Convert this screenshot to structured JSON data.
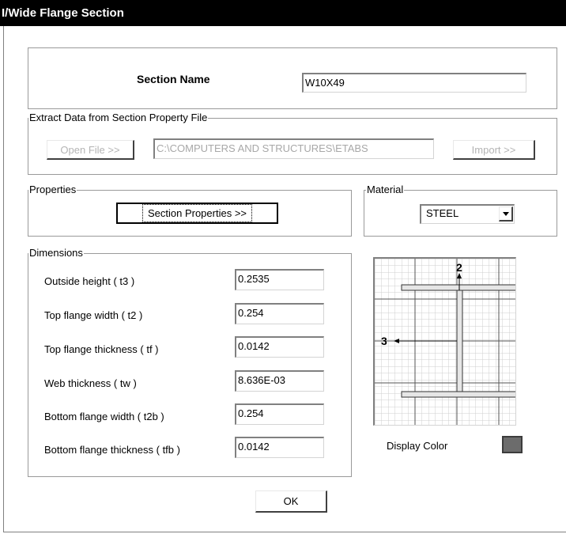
{
  "window": {
    "title": "I/Wide Flange Section"
  },
  "section_name": {
    "label": "Section Name",
    "value": "W10X49"
  },
  "extract": {
    "legend": "Extract Data from Section Property File",
    "open_file_label": "Open File >>",
    "file_path": "C:\\COMPUTERS AND STRUCTURES\\ETABS",
    "import_label": "Import >>"
  },
  "properties": {
    "legend": "Properties",
    "button_label": "Section Properties >>"
  },
  "material": {
    "legend": "Material",
    "selected": "STEEL"
  },
  "dimensions": {
    "legend": "Dimensions",
    "rows": [
      {
        "label": "Outside height  ( t3 )",
        "value": "0.2535"
      },
      {
        "label": "Top flange width  ( t2 )",
        "value": "0.254"
      },
      {
        "label": "Top flange thickness  ( tf )",
        "value": "0.0142"
      },
      {
        "label": "Web thickness  ( tw )",
        "value": "8.636E-03"
      },
      {
        "label": "Bottom flange width  ( t2b )",
        "value": "0.254"
      },
      {
        "label": "Bottom flange thickness  ( tfb )",
        "value": "0.0142"
      }
    ]
  },
  "preview": {
    "axis_vertical": "2",
    "axis_horizontal": "3"
  },
  "display_color": {
    "label": "Display Color",
    "color": "#6c6c6c"
  },
  "ok_label": "OK"
}
